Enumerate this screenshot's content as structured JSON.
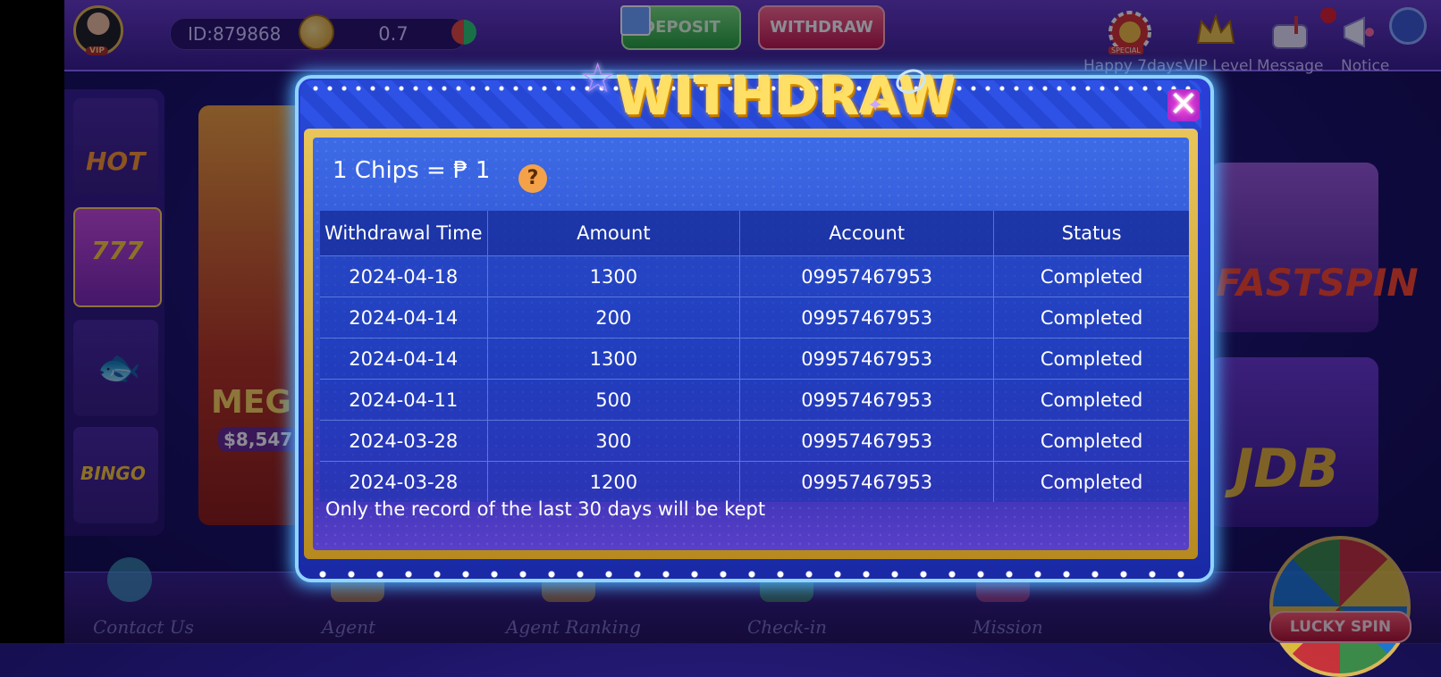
{
  "header": {
    "user_id": "ID:879868",
    "balance": "0.7",
    "deposit_label": "DEPOSIT",
    "withdraw_label": "WITHDRAW",
    "vip_badge": "VIP",
    "top_icons": [
      {
        "label": "Happy 7days",
        "badge": "SPECIAL",
        "icon": "special-chip-icon"
      },
      {
        "label": "VIP Level",
        "icon": "vip-crown-icon"
      },
      {
        "label": "Message",
        "icon": "mailbox-icon"
      },
      {
        "label": "Notice",
        "icon": "megaphone-icon"
      }
    ]
  },
  "side_menu": {
    "items": [
      {
        "label": "HOT",
        "icon": "hot-icon"
      },
      {
        "label": "777",
        "icon": "slots-icon"
      },
      {
        "label": "",
        "icon": "fish-icon"
      },
      {
        "label": "BINGO",
        "icon": "bingo-icon"
      }
    ]
  },
  "games": {
    "left_card_label": "MEG",
    "left_card_amount": "$8,547",
    "right_card_1": "FASTSPIN",
    "right_card_2": "JDB"
  },
  "bottom_nav": {
    "items": [
      "Contact Us",
      "Agent",
      "Agent Ranking",
      "Check-in",
      "Mission"
    ],
    "lucky_spin": "LUCKY SPIN"
  },
  "modal": {
    "title": "WITHDRAW",
    "rate": "1 Chips = ₱ 1",
    "help": "?",
    "close": "✕",
    "columns": [
      "Withdrawal Time",
      "Amount",
      "Account",
      "Status"
    ],
    "rows": [
      {
        "time": "2024-04-18",
        "amount": "1300",
        "account": "09957467953",
        "status": "Completed"
      },
      {
        "time": "2024-04-14",
        "amount": "200",
        "account": "09957467953",
        "status": "Completed"
      },
      {
        "time": "2024-04-14",
        "amount": "1300",
        "account": "09957467953",
        "status": "Completed"
      },
      {
        "time": "2024-04-11",
        "amount": "500",
        "account": "09957467953",
        "status": "Completed"
      },
      {
        "time": "2024-03-28",
        "amount": "300",
        "account": "09957467953",
        "status": "Completed"
      },
      {
        "time": "2024-03-28",
        "amount": "1200",
        "account": "09957467953",
        "status": "Completed"
      }
    ],
    "footnote": "Only the record of the last 30 days will be kept"
  },
  "colors": {
    "accent_gold": "#ffe066",
    "panel_blue": "#2a46c9",
    "frame_glow": "#8fd4ff"
  }
}
